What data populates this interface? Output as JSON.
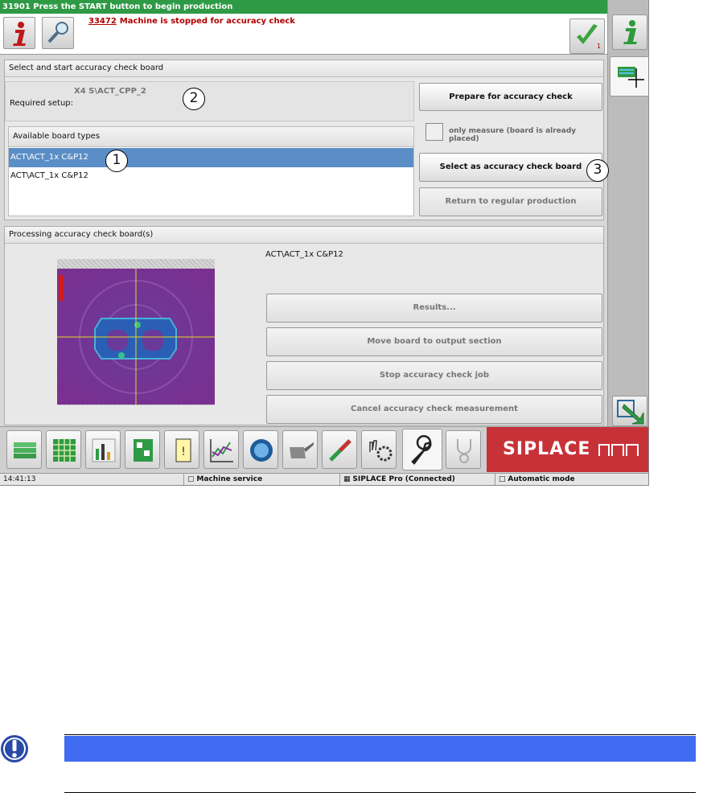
{
  "title_bar": {
    "text": "31901 Press the START button to begin production"
  },
  "message": {
    "code": "33472",
    "text": "Machine is stopped for accuracy check",
    "ack_count": "1"
  },
  "setup_panel": {
    "title": "Select and start accuracy check board",
    "required_setup_label": "Required setup:",
    "required_setup_value": "X4 S\\ACT_CPP_2",
    "board_types_header": "Available board types",
    "board_types": [
      {
        "label": "ACT\\ACT_1x C&P12",
        "selected": true
      },
      {
        "label": "ACT\\ACT_1x C&P12",
        "selected": false
      }
    ],
    "prepare_button": "Prepare for accuracy check",
    "only_measure_label": "only measure (board is already placed)",
    "select_button": "Select as accuracy check board",
    "return_button": "Return to regular production"
  },
  "processing_panel": {
    "title": "Processing accuracy check board(s)",
    "board_name": "ACT\\ACT_1x C&P12",
    "results_button": "Results...",
    "move_button": "Move board to output section",
    "stop_button": "Stop accuracy check job",
    "cancel_button": "Cancel accuracy check measurement"
  },
  "callouts": [
    "1",
    "2",
    "3"
  ],
  "brand": {
    "text": "SIPLACE"
  },
  "status_bar": {
    "time": "14:41:13",
    "user": "Machine service",
    "connection": "SIPLACE Pro (Connected)",
    "mode": "Automatic mode"
  },
  "toolbar_icons": [
    "board-stack-icon",
    "grid-icon",
    "bar-grid-icon",
    "circuit-board-icon",
    "warning-card-icon",
    "line-chart-icon",
    "camera-icon",
    "oil-can-icon",
    "nozzle-tool-icon",
    "hand-gear-icon",
    "wrench-icon",
    "stethoscope-icon"
  ],
  "colors": {
    "title_green": "#2f9a46",
    "brand_red": "#c73238",
    "selection_blue": "#5b8ec6",
    "note_blue": "#3f6cf0"
  }
}
